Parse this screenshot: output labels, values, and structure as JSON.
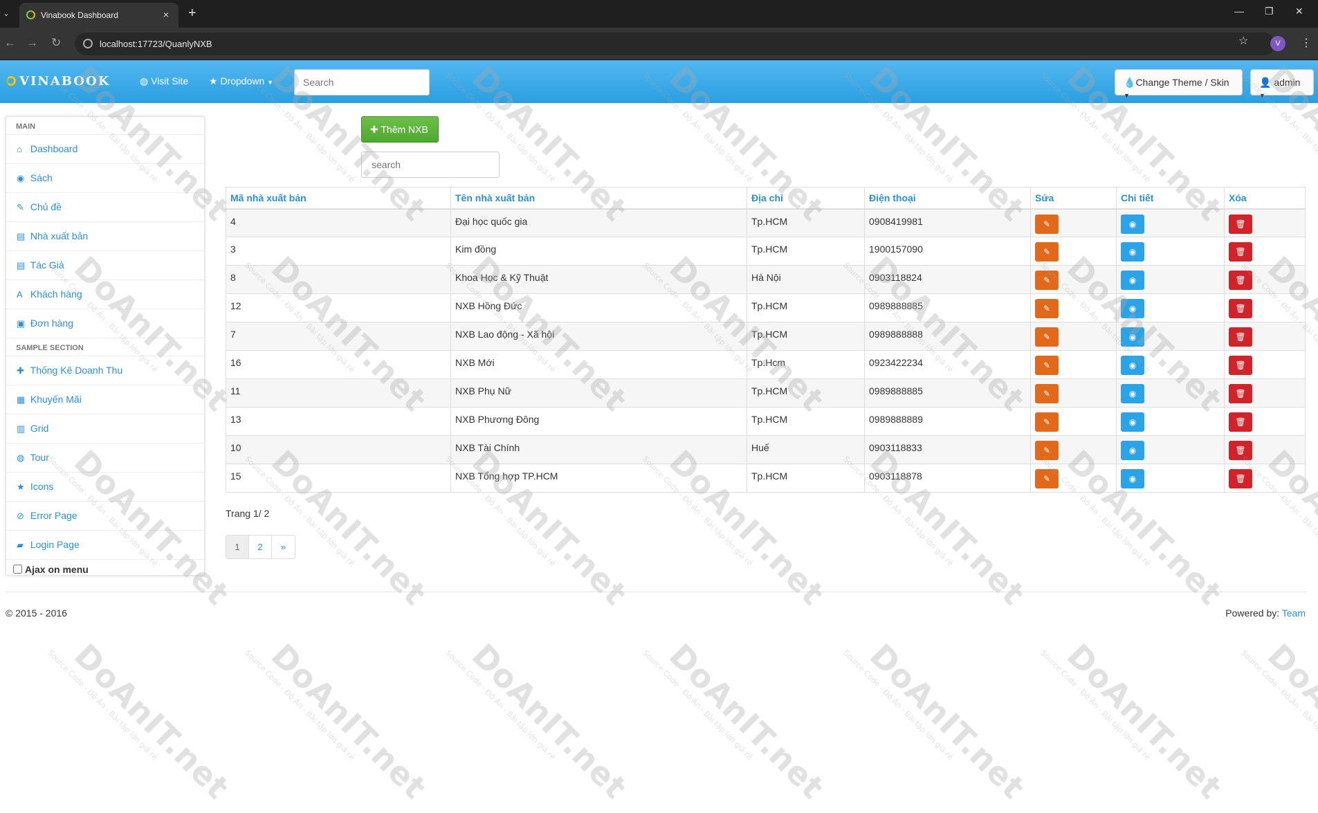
{
  "browser": {
    "tab_title": "Vinabook Dashboard",
    "tab_close": "×",
    "new_tab": "+",
    "url": "localhost:17723/QuanlyNXB",
    "profile_initial": "V"
  },
  "navbar": {
    "brand": "VINABOOK",
    "visit_site": "Visit Site",
    "dropdown": "Dropdown",
    "search_placeholder": "Search",
    "change_theme": "Change Theme / Skin",
    "user": "admin"
  },
  "sidebar": {
    "main_header": "MAIN",
    "items": [
      {
        "label": "Dashboard",
        "icon": "home-icon",
        "glyph": "⌂"
      },
      {
        "label": "Sách",
        "icon": "eye-icon",
        "glyph": "◉"
      },
      {
        "label": "Chủ đề",
        "icon": "edit-icon",
        "glyph": "✎"
      },
      {
        "label": "Nhà xuất bản",
        "icon": "list-icon",
        "glyph": "▤"
      },
      {
        "label": "Tác Giả",
        "icon": "list-icon",
        "glyph": "▤"
      },
      {
        "label": "Khách hàng",
        "icon": "font-icon",
        "glyph": "A"
      },
      {
        "label": "Đơn hàng",
        "icon": "picture-icon",
        "glyph": "▣"
      }
    ],
    "sample_header": "SAMPLE SECTION",
    "sample_items": [
      {
        "label": "Thống Kê Doanh Thu",
        "icon": "plus-icon",
        "glyph": "✚"
      },
      {
        "label": "Khuyến Mãi",
        "icon": "calendar-icon",
        "glyph": "▦"
      },
      {
        "label": "Grid",
        "icon": "grid-icon",
        "glyph": "▥"
      },
      {
        "label": "Tour",
        "icon": "globe-icon",
        "glyph": "◍"
      },
      {
        "label": "Icons",
        "icon": "star-icon",
        "glyph": "★"
      },
      {
        "label": "Error Page",
        "icon": "ban-icon",
        "glyph": "⊘"
      },
      {
        "label": "Login Page",
        "icon": "lock-icon",
        "glyph": "▰"
      }
    ],
    "ajax_label": "Ajax on menu"
  },
  "main": {
    "add_button": "Thêm NXB",
    "search_placeholder": "search",
    "columns": [
      "Mã nhà xuất bản",
      "Tên nhà xuất bản",
      "Địa chỉ",
      "Điện thoại",
      "Sửa",
      "Chi tiết",
      "Xóa"
    ],
    "rows": [
      {
        "id": "4",
        "name": "Đại học quốc gia",
        "address": "Tp.HCM",
        "phone": "0908419981"
      },
      {
        "id": "3",
        "name": "Kim đồng",
        "address": "Tp.HCM",
        "phone": "1900157090"
      },
      {
        "id": "8",
        "name": "Khoa Học & Kỹ Thuật",
        "address": "Hà Nội",
        "phone": "0903118824"
      },
      {
        "id": "12",
        "name": "NXB Hồng Đức",
        "address": "Tp.HCM",
        "phone": "0989888885"
      },
      {
        "id": "7",
        "name": "NXB Lao động - Xã hội",
        "address": "Tp.HCM",
        "phone": "0989888888"
      },
      {
        "id": "16",
        "name": "NXB Mới",
        "address": "Tp.Hcm",
        "phone": "0923422234"
      },
      {
        "id": "11",
        "name": "NXB Phụ Nữ",
        "address": "Tp.HCM",
        "phone": "0989888885"
      },
      {
        "id": "13",
        "name": "NXB Phương Đông",
        "address": "Tp.HCM",
        "phone": "0989888889"
      },
      {
        "id": "10",
        "name": "NXB Tài Chính",
        "address": "Huế",
        "phone": "0903118833"
      },
      {
        "id": "15",
        "name": "NXB Tổng hợp TP.HCM",
        "address": "Tp.HCM",
        "phone": "0903118878"
      }
    ],
    "page_info": "Trang 1/ 2",
    "pages": [
      "1",
      "2",
      "»"
    ]
  },
  "footer": {
    "copyright": "© 2015 - 2016",
    "powered_by": "Powered by:",
    "team": "Team"
  },
  "watermark": {
    "main": "DoAnIT.net",
    "sub": "Source Code - Đồ Án - Bài tập lớn giá rẻ"
  },
  "colors": {
    "navbar": "#2a9fe0",
    "link": "#2a8fd9",
    "edit": "#e2691a",
    "view": "#2aa4e6",
    "delete": "#d0232a",
    "add": "#5cb85c"
  }
}
